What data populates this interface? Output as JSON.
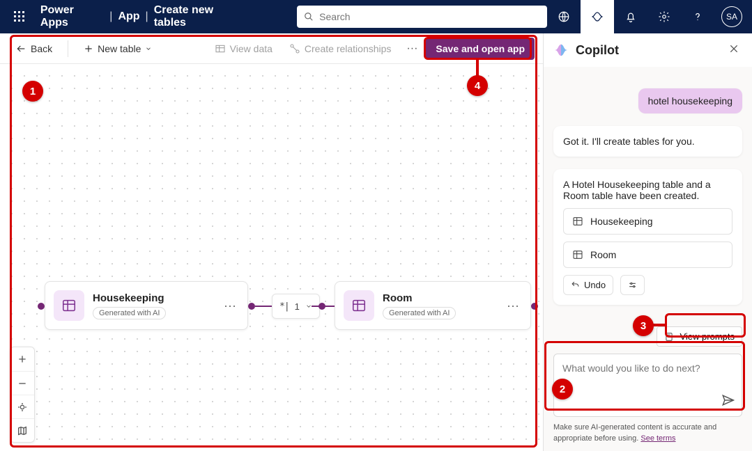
{
  "header": {
    "app_name": "Power Apps",
    "crumb1": "App",
    "crumb2": "Create new tables",
    "search_placeholder": "Search",
    "avatar_initials": "SA"
  },
  "toolbar": {
    "back_label": "Back",
    "newtable_label": "New table",
    "viewdata_label": "View data",
    "createrel_label": "Create relationships",
    "save_label": "Save and open app"
  },
  "canvas": {
    "table1": {
      "title": "Housekeeping",
      "badge": "Generated with AI"
    },
    "table2": {
      "title": "Room",
      "badge": "Generated with AI"
    },
    "rel_label": "1"
  },
  "copilot": {
    "title": "Copilot",
    "user_msg": "hotel housekeeping",
    "bot_msg1": "Got it. I'll create tables for you.",
    "bot_msg2": "A Hotel Housekeeping table and a Room table have been created.",
    "table_btn1": "Housekeeping",
    "table_btn2": "Room",
    "undo_label": "Undo",
    "viewprompts_label": "View prompts",
    "input_placeholder": "What would you like to do next?",
    "disclaimer": "Make sure AI-generated content is accurate and appropriate before using. ",
    "seeterms_label": "See terms"
  },
  "callouts": {
    "c1": "1",
    "c2": "2",
    "c3": "3",
    "c4": "4"
  }
}
